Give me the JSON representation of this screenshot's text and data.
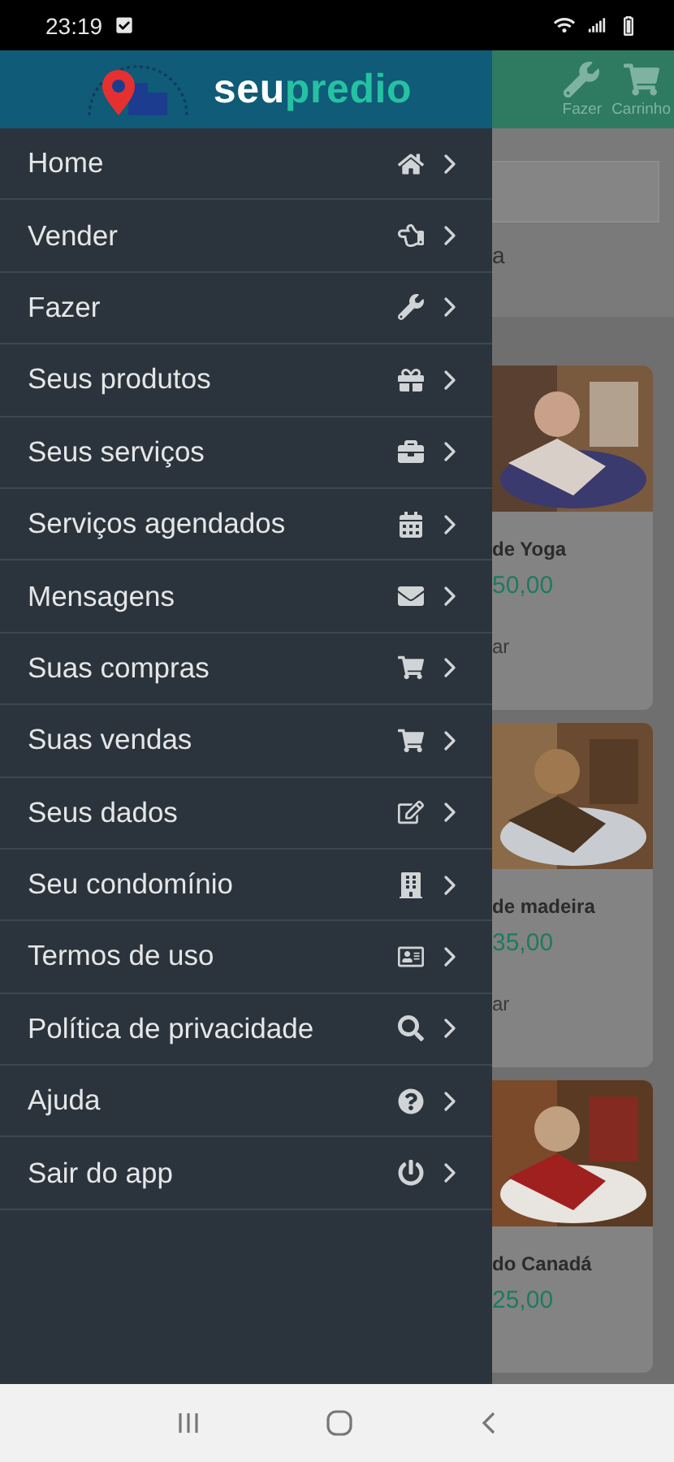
{
  "status_bar": {
    "time": "23:19"
  },
  "drawer": {
    "logo": {
      "first": "seu",
      "second": "predio"
    },
    "items": [
      {
        "label": "Home"
      },
      {
        "label": "Vender"
      },
      {
        "label": "Fazer"
      },
      {
        "label": "Seus produtos"
      },
      {
        "label": "Seus serviços"
      },
      {
        "label": "Serviços agendados"
      },
      {
        "label": "Mensagens"
      },
      {
        "label": "Suas compras"
      },
      {
        "label": "Suas vendas"
      },
      {
        "label": "Seus dados"
      },
      {
        "label": "Seu condomínio"
      },
      {
        "label": "Termos de uso"
      },
      {
        "label": "Política de privacidade"
      },
      {
        "label": "Ajuda"
      },
      {
        "label": "Sair do app"
      }
    ]
  },
  "background": {
    "header_actions": [
      {
        "label": "Fazer"
      },
      {
        "label": "Carrinho"
      }
    ],
    "partial_text": "a",
    "cards": [
      {
        "title": "de Yoga",
        "price": "50,00",
        "action": "ar"
      },
      {
        "title": "de madeira",
        "price": "35,00",
        "action": "ar"
      },
      {
        "title": "do Canadá",
        "price": "25,00"
      }
    ]
  }
}
